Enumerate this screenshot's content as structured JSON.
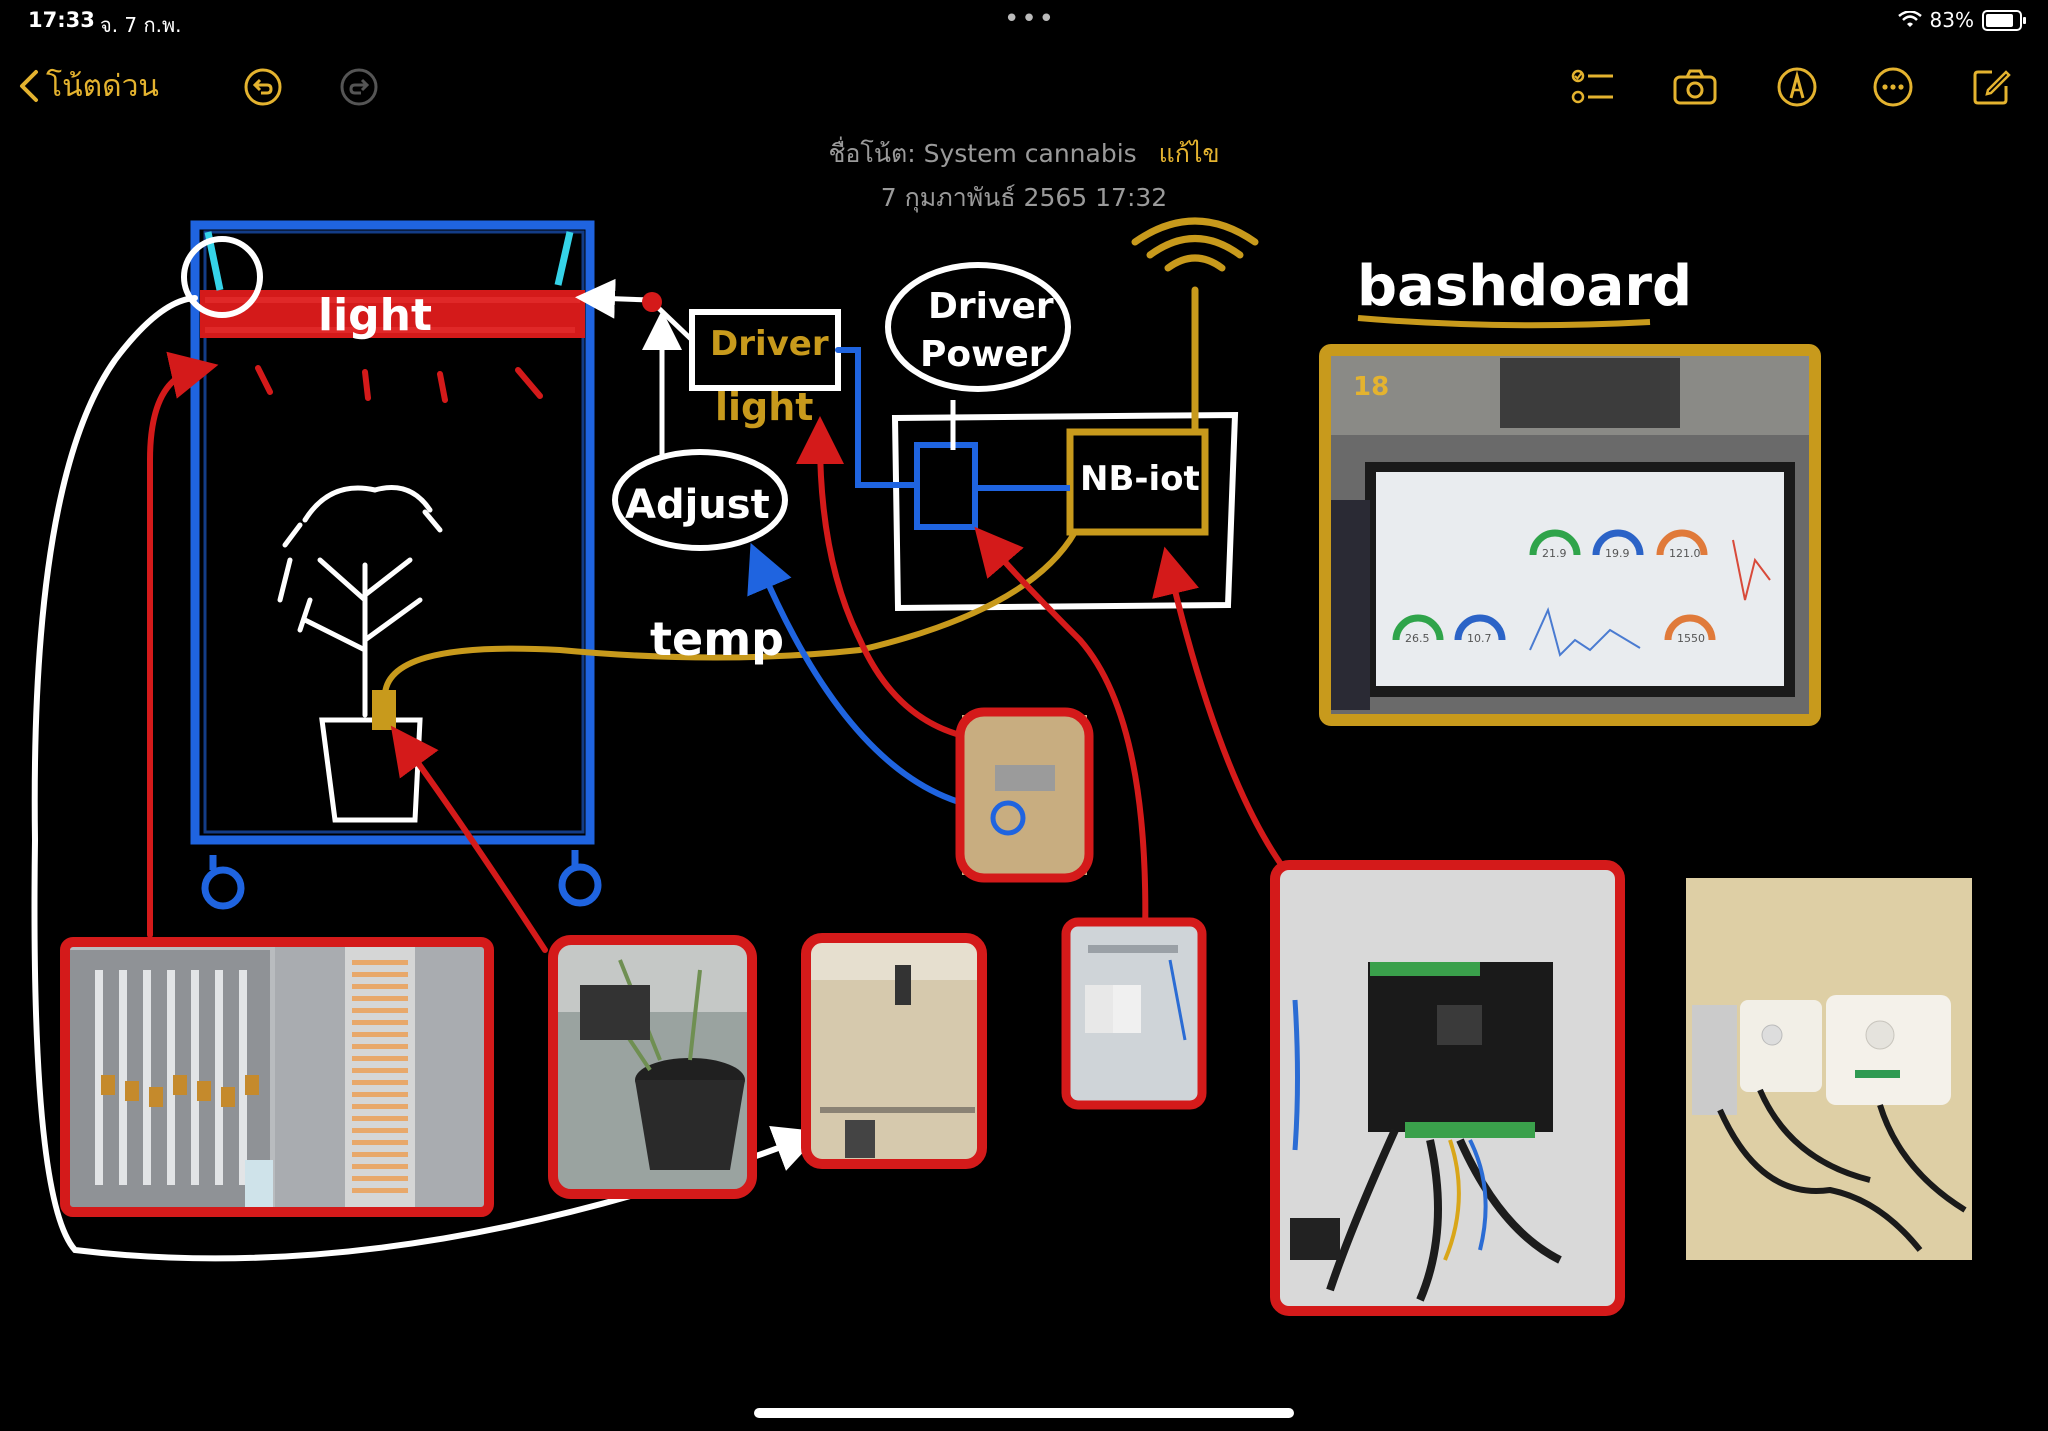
{
  "status": {
    "time": "17:33",
    "date": "จ. 7 ก.พ.",
    "dots": "•••",
    "battery": "83%",
    "battery_level": 0.83
  },
  "toolbar": {
    "back_label": "โน้ตด่วน",
    "accent": "#e4b32f"
  },
  "note": {
    "title_prefix": "ชื่อโน้ต:",
    "title": "System cannabis",
    "edit_label": "แก้ไข",
    "date": "7 กุมภาพันธ์ 2565 17:32"
  },
  "sketch": {
    "light": "light",
    "driver_light_1": "Driver",
    "driver_light_2": "light",
    "driver_power_1": "Driver",
    "driver_power_2": "Power",
    "adjust": "Adjust",
    "nbiot": "NB-iot",
    "temp": "temp",
    "dashboard": "bashdoard",
    "photo_number": "18"
  },
  "dashboard_gauges": [
    "21.9",
    "19.9",
    "121.0",
    "26.5",
    "10.7",
    "1550"
  ],
  "colors": {
    "red": "#d41a1a",
    "blue": "#1f64e0",
    "gold": "#c89a1c",
    "white": "#ffffff",
    "cyan": "#35d3e8"
  }
}
